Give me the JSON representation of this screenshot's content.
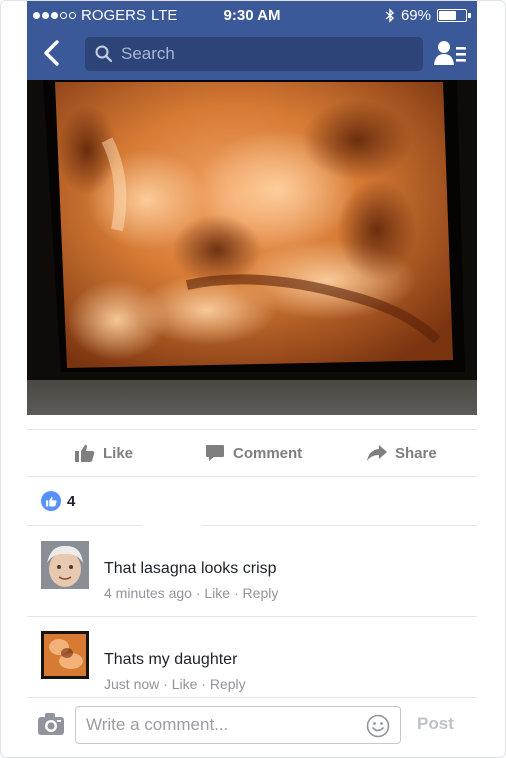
{
  "status_bar": {
    "carrier": "ROGERS",
    "network": "LTE",
    "time": "9:30 AM",
    "battery_percent": "69%",
    "battery_level": 0.69,
    "signal_bars_filled": 3,
    "signal_bars_total": 5
  },
  "nav": {
    "search_placeholder": "Search",
    "icons": [
      "back-chevron-icon",
      "search-icon",
      "friends-icon"
    ]
  },
  "post": {
    "actions": {
      "like_label": "Like",
      "comment_label": "Comment",
      "share_label": "Share"
    },
    "reaction_count": "4"
  },
  "comments": [
    {
      "text": "That lasagna looks crisp",
      "time": "4 minutes ago",
      "like_label": "Like",
      "reply_label": "Reply"
    },
    {
      "text": "Thats my daughter",
      "time": "Just now",
      "like_label": "Like",
      "reply_label": "Reply"
    }
  ],
  "composer": {
    "placeholder": "Write a comment...",
    "post_label": "Post"
  },
  "colors": {
    "brand": "#3b5998",
    "like_blue": "#5890ff",
    "muted": "#90949c"
  }
}
